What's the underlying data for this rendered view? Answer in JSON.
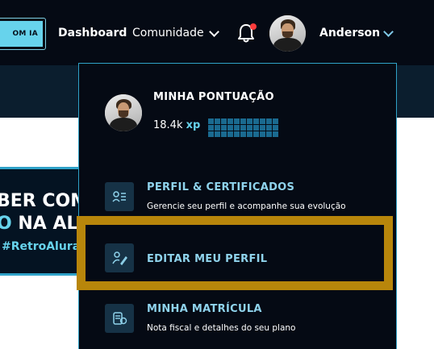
{
  "topbar": {
    "cta_label": "OM IA",
    "links": [
      {
        "label": "Dashboard"
      },
      {
        "label": "Comunidade"
      }
    ],
    "user_name": "Anderson",
    "icons": {
      "notification": "bell-icon",
      "community_chevron": "chevron-down-icon",
      "user_chevron": "chevron-down-icon"
    },
    "notification_dot_color": "#ff3b3b"
  },
  "banner": {
    "line1": "BER COM",
    "line2_accent": "O",
    "line2_rest": " NA ALU",
    "line3": "#RetroAlura"
  },
  "dropdown": {
    "score_title": "MINHA PONTUAÇÃO",
    "xp_value": "18.4k",
    "xp_unit": "xp",
    "items": [
      {
        "title": "PERFIL & CERTIFICADOS",
        "description": "Gerencie seu perfil e acompanhe sua evolução",
        "icon": "profile-card-icon"
      },
      {
        "title": "EDITAR MEU PERFIL",
        "description": "",
        "icon": "edit-profile-icon"
      },
      {
        "title": "MINHA MATRÍCULA",
        "description": "Nota fiscal e detalhes do seu plano",
        "icon": "enrollment-icon"
      }
    ]
  },
  "colors": {
    "background_dark": "#050a14",
    "accent": "#67d3ec",
    "highlight": "#b8860b"
  }
}
